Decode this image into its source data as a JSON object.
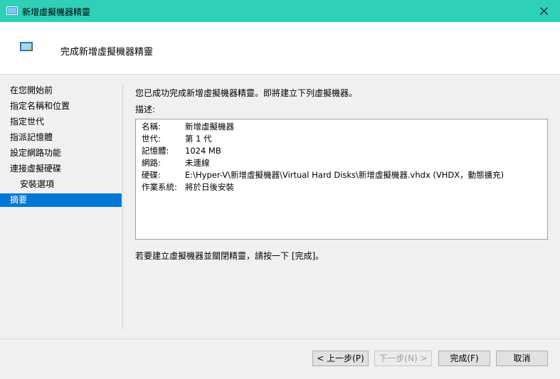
{
  "window": {
    "title": "新增虛擬機器精靈",
    "close_label": "✕"
  },
  "header": {
    "title": "完成新增虛擬機器精靈"
  },
  "sidebar": {
    "items": [
      {
        "label": "在您開始前"
      },
      {
        "label": "指定名稱和位置"
      },
      {
        "label": "指定世代"
      },
      {
        "label": "指派記憶體"
      },
      {
        "label": "設定網路功能"
      },
      {
        "label": "連接虛擬硬碟"
      },
      {
        "label": "安裝選項"
      },
      {
        "label": "摘要"
      }
    ],
    "active_index": 7
  },
  "main": {
    "intro": "您已成功完成新增虛擬機器精靈。即將建立下列虛擬機器。",
    "description_label": "描述:",
    "summary": [
      {
        "key": "名稱:",
        "value": "新增虛擬機器"
      },
      {
        "key": "世代:",
        "value": "第 1 代"
      },
      {
        "key": "記憶體:",
        "value": "1024 MB"
      },
      {
        "key": "網路:",
        "value": "未連線"
      },
      {
        "key": "硬碟:",
        "value": "E:\\Hyper-V\\新增虛擬機器\\Virtual Hard Disks\\新增虛擬機器.vhdx (VHDX，動態擴充)"
      },
      {
        "key": "作業系統:",
        "value": "將於日後安裝"
      }
    ],
    "finish_note": "若要建立虛擬機器並關閉精靈，請按一下 [完成]。"
  },
  "buttons": {
    "previous": "< 上一步(P)",
    "next": "下一步(N) >",
    "finish": "完成(F)",
    "cancel": "取消"
  },
  "colors": {
    "titlebar": "#2fd0b8",
    "selection": "#0078d7"
  }
}
